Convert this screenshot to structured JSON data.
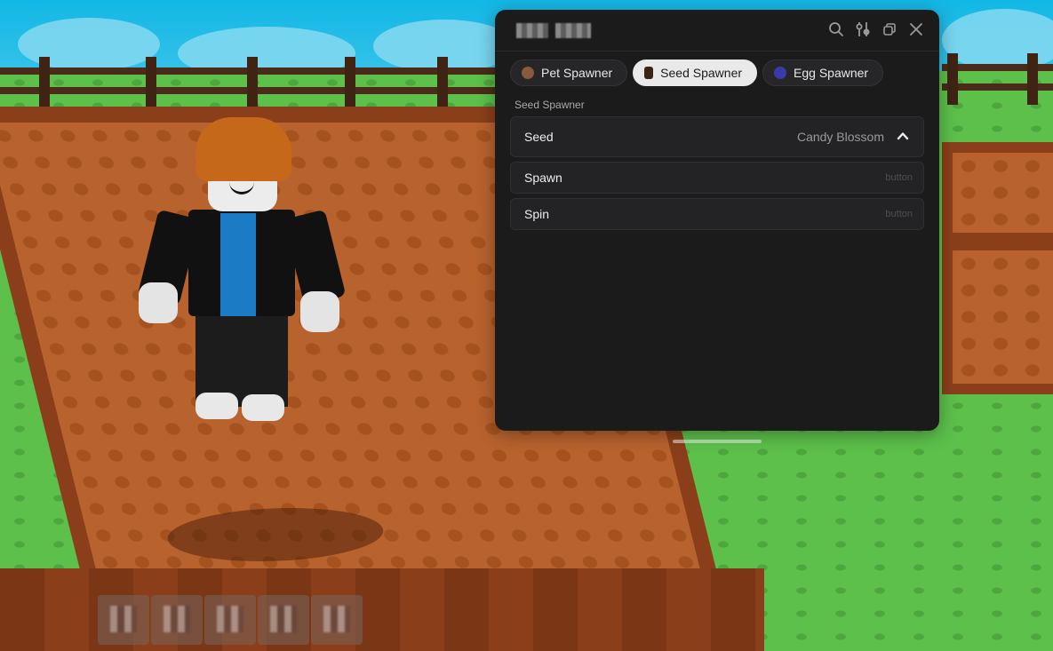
{
  "window": {
    "title": "",
    "header_icons": [
      "search-icon",
      "sliders-icon",
      "restore-window-icon",
      "close-icon"
    ]
  },
  "tabs": [
    {
      "label": "Pet Spawner",
      "icon": "pet-icon",
      "active": false,
      "icon_color": "#8a5a3c"
    },
    {
      "label": "Seed Spawner",
      "icon": "seed-icon",
      "active": true,
      "icon_color": "#3a2414"
    },
    {
      "label": "Egg Spawner",
      "icon": "egg-icon",
      "active": false,
      "icon_color": "#3a3aa8"
    }
  ],
  "section": {
    "label": "Seed Spawner"
  },
  "seed_dropdown": {
    "label": "Seed",
    "value": "Candy Blossom",
    "expanded": true
  },
  "buttons": [
    {
      "label": "Spawn",
      "hint": "button"
    },
    {
      "label": "Spin",
      "hint": "button"
    }
  ],
  "colors": {
    "panel_bg": "#1b1b1c",
    "row_bg": "#232325",
    "active_tab_bg": "#e9e9ea",
    "text_primary": "#e8e8e8",
    "text_secondary": "#9a9a9e"
  },
  "hotbar": {
    "slot_count": 5
  }
}
